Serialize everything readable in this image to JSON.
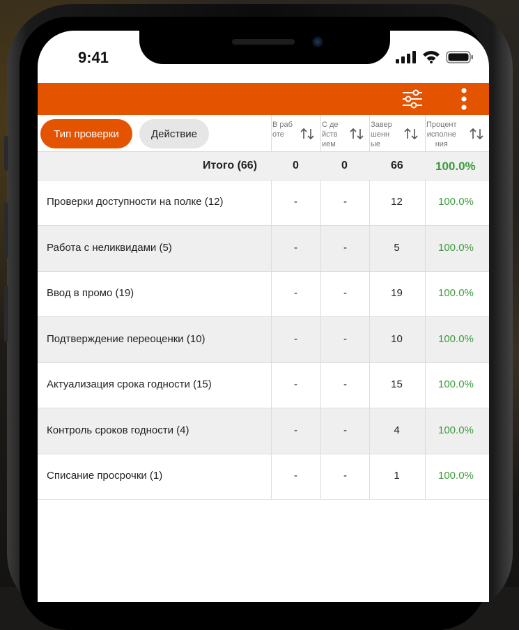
{
  "status_bar": {
    "time": "9:41"
  },
  "tabs": {
    "active": "Тип проверки",
    "inactive": "Действие"
  },
  "columns": [
    {
      "label": "В раб\nоте"
    },
    {
      "label": "С де\nйств\nием"
    },
    {
      "label": "Завер\nшенн\nые"
    },
    {
      "label": "Процент\nисполне\nния"
    }
  ],
  "total": {
    "label": "Итого (66)",
    "in_work": "0",
    "with_action": "0",
    "completed": "66",
    "percent": "100.0%"
  },
  "rows": [
    {
      "name": "Проверки доступности на полке  (12)",
      "in_work": "-",
      "with_action": "-",
      "completed": "12",
      "percent": "100.0%"
    },
    {
      "name": "Работа с неликвидами  (5)",
      "in_work": "-",
      "with_action": "-",
      "completed": "5",
      "percent": "100.0%"
    },
    {
      "name": "Ввод в промо  (19)",
      "in_work": "-",
      "with_action": "-",
      "completed": "19",
      "percent": "100.0%"
    },
    {
      "name": "Подтверждение переоценки  (10)",
      "in_work": "-",
      "with_action": "-",
      "completed": "10",
      "percent": "100.0%"
    },
    {
      "name": "Актуализация срока годности  (15)",
      "in_work": "-",
      "with_action": "-",
      "completed": "15",
      "percent": "100.0%"
    },
    {
      "name": "Контроль сроков годности  (4)",
      "in_work": "-",
      "with_action": "-",
      "completed": "4",
      "percent": "100.0%"
    },
    {
      "name": "Списание просрочки  (1)",
      "in_work": "-",
      "with_action": "-",
      "completed": "1",
      "percent": "100.0%"
    }
  ],
  "colors": {
    "accent": "#e45300",
    "percent": "#3d9a3d"
  },
  "icons": {
    "filter": "sliders-icon",
    "menu": "more-vertical-icon",
    "sort": "sort-arrows-icon"
  }
}
